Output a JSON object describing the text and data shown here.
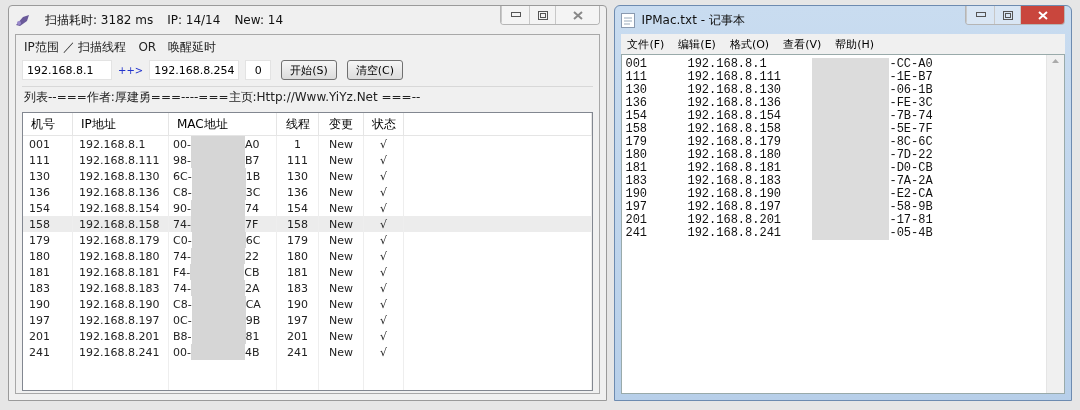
{
  "scanner": {
    "title_stats": [
      "扫描耗时: 3182 ms",
      "IP: 14/14",
      "New: 14"
    ],
    "range_legend": "IP范围 ／ 扫描线程　OR　唤醒延时",
    "start_ip": "192.168.8.1",
    "arrow": "++>",
    "end_ip": "192.168.8.254",
    "delay": "0",
    "buttons": [
      "开始(S)",
      "清空(C)"
    ],
    "list_legend": "列表--===作者:厚建勇===----===主页:Http://Www.YiYz.Net ===--",
    "columns": [
      "机号",
      "IP地址",
      "MAC地址",
      "线程",
      "变更",
      "状态"
    ],
    "rows": [
      {
        "no": "001",
        "ip": "192.168.8.1",
        "mac_start": "00-",
        "mac_end": "A0",
        "thread": "1",
        "change": "New",
        "status": "√",
        "selected": false
      },
      {
        "no": "111",
        "ip": "192.168.8.111",
        "mac_start": "98-",
        "mac_end": "B7",
        "thread": "111",
        "change": "New",
        "status": "√",
        "selected": false
      },
      {
        "no": "130",
        "ip": "192.168.8.130",
        "mac_start": "6C-",
        "mac_end": "1B",
        "thread": "130",
        "change": "New",
        "status": "√",
        "selected": false
      },
      {
        "no": "136",
        "ip": "192.168.8.136",
        "mac_start": "C8-",
        "mac_end": "3C",
        "thread": "136",
        "change": "New",
        "status": "√",
        "selected": false
      },
      {
        "no": "154",
        "ip": "192.168.8.154",
        "mac_start": "90-",
        "mac_end": "74",
        "thread": "154",
        "change": "New",
        "status": "√",
        "selected": false
      },
      {
        "no": "158",
        "ip": "192.168.8.158",
        "mac_start": "74-",
        "mac_end": "7F",
        "thread": "158",
        "change": "New",
        "status": "√",
        "selected": true
      },
      {
        "no": "179",
        "ip": "192.168.8.179",
        "mac_start": "C0-",
        "mac_end": "6C",
        "thread": "179",
        "change": "New",
        "status": "√",
        "selected": false
      },
      {
        "no": "180",
        "ip": "192.168.8.180",
        "mac_start": "74-",
        "mac_end": "22",
        "thread": "180",
        "change": "New",
        "status": "√",
        "selected": false
      },
      {
        "no": "181",
        "ip": "192.168.8.181",
        "mac_start": "F4-",
        "mac_end": "CB",
        "thread": "181",
        "change": "New",
        "status": "√",
        "selected": false
      },
      {
        "no": "183",
        "ip": "192.168.8.183",
        "mac_start": "74-",
        "mac_end": "2A",
        "thread": "183",
        "change": "New",
        "status": "√",
        "selected": false
      },
      {
        "no": "190",
        "ip": "192.168.8.190",
        "mac_start": "C8-",
        "mac_end": "CA",
        "thread": "190",
        "change": "New",
        "status": "√",
        "selected": false
      },
      {
        "no": "197",
        "ip": "192.168.8.197",
        "mac_start": "0C-",
        "mac_end": "9B",
        "thread": "197",
        "change": "New",
        "status": "√",
        "selected": false
      },
      {
        "no": "201",
        "ip": "192.168.8.201",
        "mac_start": "B8-",
        "mac_end": "81",
        "thread": "201",
        "change": "New",
        "status": "√",
        "selected": false
      },
      {
        "no": "241",
        "ip": "192.168.8.241",
        "mac_start": "00-",
        "mac_end": "4B",
        "thread": "241",
        "change": "New",
        "status": "√",
        "selected": false
      }
    ]
  },
  "notepad": {
    "title": "IPMac.txt - 记事本",
    "menu": [
      "文件(F)",
      "编辑(E)",
      "格式(O)",
      "查看(V)",
      "帮助(H)"
    ],
    "lines": [
      {
        "no": "001",
        "ip": "192.168.8.1",
        "mac_end": "-CC-A0"
      },
      {
        "no": "111",
        "ip": "192.168.8.111",
        "mac_end": "-1E-B7"
      },
      {
        "no": "130",
        "ip": "192.168.8.130",
        "mac_end": "-06-1B"
      },
      {
        "no": "136",
        "ip": "192.168.8.136",
        "mac_end": "-FE-3C"
      },
      {
        "no": "154",
        "ip": "192.168.8.154",
        "mac_end": "-7B-74"
      },
      {
        "no": "158",
        "ip": "192.168.8.158",
        "mac_end": "-5E-7F"
      },
      {
        "no": "179",
        "ip": "192.168.8.179",
        "mac_end": "-8C-6C"
      },
      {
        "no": "180",
        "ip": "192.168.8.180",
        "mac_end": "-7D-22"
      },
      {
        "no": "181",
        "ip": "192.168.8.181",
        "mac_end": "-D0-CB"
      },
      {
        "no": "183",
        "ip": "192.168.8.183",
        "mac_end": "-7A-2A"
      },
      {
        "no": "190",
        "ip": "192.168.8.190",
        "mac_end": "-E2-CA"
      },
      {
        "no": "197",
        "ip": "192.168.8.197",
        "mac_end": "-58-9B"
      },
      {
        "no": "201",
        "ip": "192.168.8.201",
        "mac_end": "-17-81"
      },
      {
        "no": "241",
        "ip": "192.168.8.241",
        "mac_end": "-05-4B"
      }
    ]
  }
}
